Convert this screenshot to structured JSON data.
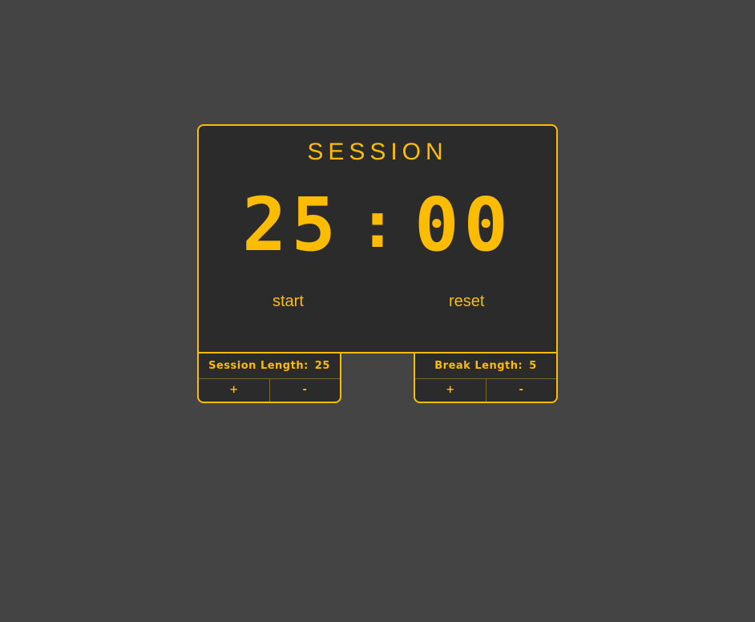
{
  "clock": {
    "mode": "SESSION",
    "minutes": "25",
    "separator": ":",
    "seconds": "00",
    "start_label": "start",
    "reset_label": "reset"
  },
  "session": {
    "label": "Session Length:",
    "value": "25",
    "increment": "+",
    "decrement": "-"
  },
  "break": {
    "label": "Break Length:",
    "value": "5",
    "increment": "+",
    "decrement": "-"
  },
  "colors": {
    "accent": "#fdbc04",
    "panel": "#2b2b2b",
    "background": "#444444"
  }
}
